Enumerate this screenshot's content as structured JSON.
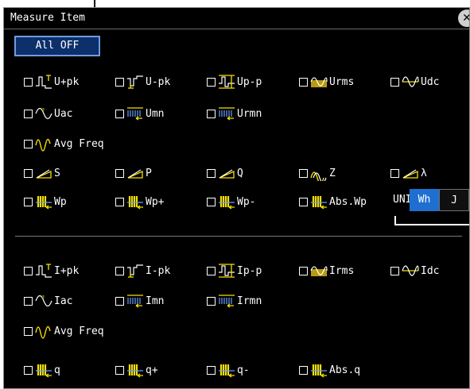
{
  "window": {
    "title": "Measure Item"
  },
  "toolbar": {
    "all_off_label": "All OFF"
  },
  "voltage": {
    "row1": [
      "U+pk",
      "U-pk",
      "Up-p",
      "Urms",
      "Udc"
    ],
    "row2": [
      "Uac",
      "Umn",
      "Urmn"
    ],
    "row3": [
      "Avg Freq"
    ],
    "row4": [
      "S",
      "P",
      "Q",
      "Z",
      "λ"
    ],
    "row5": [
      "Wp",
      "Wp+",
      "Wp-",
      "Abs.Wp"
    ]
  },
  "unit": {
    "label": "UNIT",
    "options": [
      "Wh",
      "J"
    ],
    "selected": "Wh"
  },
  "current": {
    "row1": [
      "I+pk",
      "I-pk",
      "Ip-p",
      "Irms",
      "Idc"
    ],
    "row2": [
      "Iac",
      "Imn",
      "Irmn"
    ],
    "row3": [
      "Avg Freq"
    ],
    "row4": [
      "q",
      "q+",
      "q-",
      "Abs.q"
    ]
  },
  "icons": {
    "peak": "peak-waveform-icon",
    "rms": "rms-waveform-icon",
    "dc": "dc-waveform-icon",
    "ac": "ac-waveform-icon",
    "mean": "mean-waveform-icon",
    "freq": "frequency-waveform-icon",
    "power": "power-triangle-icon",
    "impedance": "impedance-icon",
    "integration": "integration-icon"
  },
  "colors": {
    "accent": "#1f6fd0",
    "icon": "#f5e000",
    "background": "#000000"
  }
}
